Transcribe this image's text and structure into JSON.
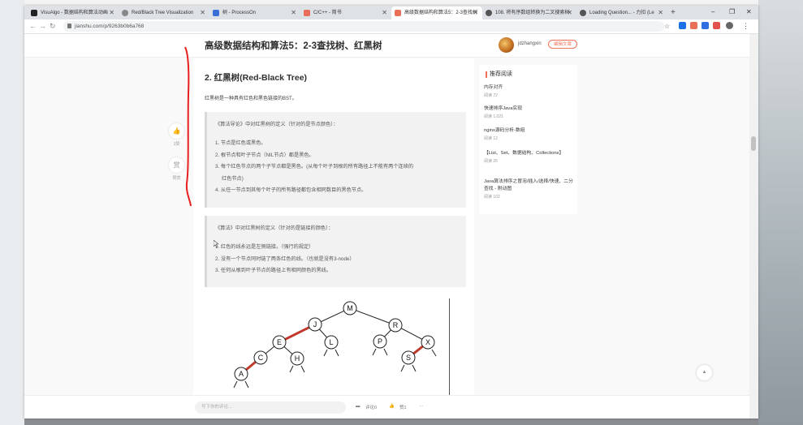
{
  "browser": {
    "tabs": [
      {
        "label": "VisuAlgo - 数据结构和算法动画",
        "color": "#222"
      },
      {
        "label": "Red/Black Tree Visualization",
        "color": "#888"
      },
      {
        "label": "树 - ProcessOn",
        "color": "#3b6fd8"
      },
      {
        "label": "C/C++ - 简书",
        "color": "#ea6f5a"
      },
      {
        "label": "高级数据结构和算法5：2-3查找树",
        "color": "#ea6f5a"
      },
      {
        "label": "108. 将有序数组转换为二叉搜索树",
        "color": "#555"
      },
      {
        "label": "Loading Question... - 力扣 (Le",
        "color": "#555"
      }
    ],
    "url": "jianshu.com/p/9263b0b6a768"
  },
  "article": {
    "title": "高级数据结构和算法5：2-3查找树、红黑树",
    "author": "jdzhangxin",
    "edit_label": "编辑文章",
    "heading": "2. 红黑树(Red-Black Tree)",
    "intro": "红黑树是一种具有红色和黑色链接的BST。",
    "quote1": {
      "lead": "《算法导论》中对红黑树的定义（针对的是节点颜色）：",
      "items": [
        "1. 节点是红色或黑色。",
        "2. 根节点和叶子节点（NIL节点）都是黑色。",
        "3. 每个红色节点的两个子节点都是黑色。(从每个叶子到根的所有路径上不能有两个连续的",
        "红色节点)",
        "4. 从任一节点到其每个叶子的所有路径都包含相同数目的黑色节点。"
      ]
    },
    "quote2": {
      "lead": "《算法》中对红黑树的定义（针对的是链接的颜色）：",
      "items": [
        "1. 红色的线永远是左侧链接。（强行的规定）",
        "2. 没有一个节点同时链了两条红色的线。（也就是没有3-node）",
        "3. 任何从根到叶子节点的路径上有相同颜色的黑线。"
      ]
    },
    "tree_nodes": [
      "M",
      "J",
      "R",
      "E",
      "L",
      "P",
      "X",
      "C",
      "H",
      "S",
      "A"
    ]
  },
  "actions": {
    "like_count": "1赞",
    "reward_icon_text": "赏",
    "reward_label": "赞赏"
  },
  "sidebar": {
    "title": "推荐阅读",
    "items": [
      {
        "title": "内存对齐",
        "reads": "阅读 72"
      },
      {
        "title": "快速排序Java实现",
        "reads": "阅读 1,021"
      },
      {
        "title": "nginx源码分析-数组",
        "reads": "阅读 12"
      },
      {
        "title": "【List、Set、数据结构、Collections】",
        "reads": "阅读 26"
      },
      {
        "title": "Java算法排序之冒泡/插入/选择/快速、二分查找 - 附动图",
        "reads": "阅读 102"
      }
    ]
  },
  "bottom": {
    "comment_placeholder": "写下你的评论...",
    "comment_count": "评论0",
    "like": "赞1",
    "more": "···"
  },
  "colors": {
    "accent": "#ec7259",
    "red_link": "#c0392b",
    "annotation": "#e8201e"
  }
}
